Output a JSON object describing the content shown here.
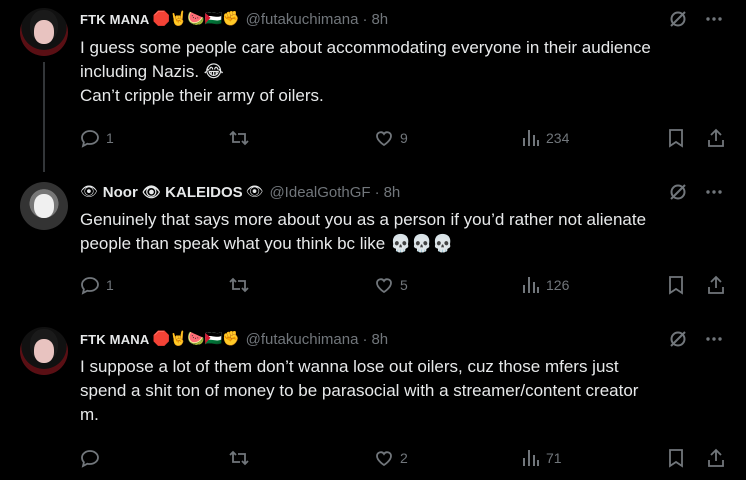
{
  "tweets": [
    {
      "name": "FTK MANA",
      "name_emoji": "🛑🤘🍉🇵🇸✊",
      "handle": "@futakuchimana",
      "time": "8h",
      "lines": [
        "I guess some people care about accommodating everyone in their audience",
        "including Nazis. 😂",
        "Can’t cripple their army of oilers."
      ],
      "replies": "1",
      "reposts": "",
      "likes": "9",
      "views": "234"
    },
    {
      "name_prefix_emoji": "👁",
      "name": "Noor 👁 KALEIDOS",
      "name_emoji": "👁",
      "handle": "@IdealGothGF",
      "time": "8h",
      "lines": [
        "Genuinely that says more about you as a person if you’d rather not alienate",
        "people than speak what you think bc like 💀💀💀"
      ],
      "replies": "1",
      "reposts": "",
      "likes": "5",
      "views": "126"
    },
    {
      "name": "FTK MANA",
      "name_emoji": "🛑🤘🍉🇵🇸✊",
      "handle": "@futakuchimana",
      "time": "8h",
      "lines": [
        "I suppose a lot of them don’t wanna lose out oilers, cuz those mfers just",
        "spend a shit ton of money to be parasocial with a streamer/content creator",
        "m."
      ],
      "replies": "",
      "reposts": "",
      "likes": "2",
      "views": "71"
    }
  ],
  "icons": {
    "reply": "reply-icon",
    "repost": "repost-icon",
    "like": "heart-icon",
    "views": "views-icon",
    "bookmark": "bookmark-icon",
    "share": "share-icon",
    "grok": "grok-icon",
    "more": "more-icon"
  },
  "colors": {
    "background": "#000000",
    "text": "#e7e9ea",
    "muted": "#71767b"
  }
}
